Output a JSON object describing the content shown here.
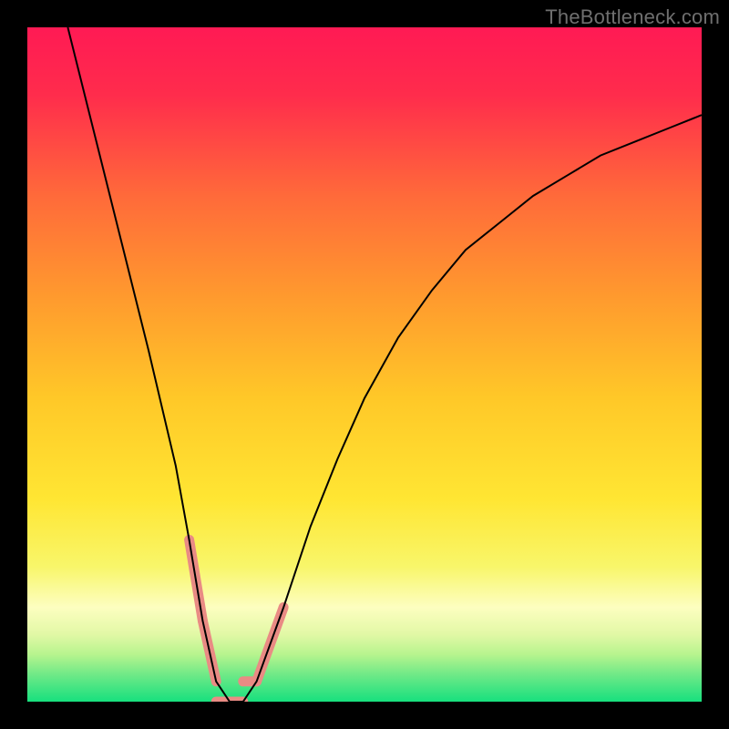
{
  "attribution": "TheBottleneck.com",
  "chart_data": {
    "type": "line",
    "title": "",
    "xlabel": "",
    "ylabel": "",
    "xlim": [
      0,
      100
    ],
    "ylim": [
      0,
      100
    ],
    "series": [
      {
        "name": "bottleneck-curve",
        "x": [
          6,
          10,
          14,
          18,
          22,
          24,
          26,
          28,
          30,
          32,
          34,
          38,
          42,
          46,
          50,
          55,
          60,
          65,
          70,
          75,
          80,
          85,
          90,
          95,
          100
        ],
        "values": [
          100,
          84,
          68,
          52,
          35,
          24,
          12,
          3,
          0,
          0,
          3,
          14,
          26,
          36,
          45,
          54,
          61,
          67,
          71,
          75,
          78,
          81,
          83,
          85,
          87
        ],
        "color": "#000000"
      }
    ],
    "highlights": {
      "name": "marker-band",
      "color": "#e98b84",
      "segments": [
        {
          "x": [
            24,
            26
          ],
          "y": [
            24,
            12
          ]
        },
        {
          "x": [
            26,
            28
          ],
          "y": [
            12,
            3
          ]
        },
        {
          "x": [
            28,
            32
          ],
          "y": [
            0,
            0
          ]
        },
        {
          "x": [
            32,
            34
          ],
          "y": [
            3,
            3
          ]
        },
        {
          "x": [
            34,
            38
          ],
          "y": [
            3,
            14
          ]
        }
      ]
    },
    "background_gradient": {
      "stops": [
        {
          "offset": 0.0,
          "color": "#ff1a54"
        },
        {
          "offset": 0.1,
          "color": "#ff2c4c"
        },
        {
          "offset": 0.25,
          "color": "#ff6a3a"
        },
        {
          "offset": 0.4,
          "color": "#ff9a2e"
        },
        {
          "offset": 0.55,
          "color": "#ffc828"
        },
        {
          "offset": 0.7,
          "color": "#ffe633"
        },
        {
          "offset": 0.8,
          "color": "#f8f66a"
        },
        {
          "offset": 0.86,
          "color": "#fdfec0"
        },
        {
          "offset": 0.9,
          "color": "#e2f8a6"
        },
        {
          "offset": 0.93,
          "color": "#b7f48e"
        },
        {
          "offset": 0.96,
          "color": "#6fe987"
        },
        {
          "offset": 1.0,
          "color": "#17e07e"
        }
      ]
    }
  }
}
